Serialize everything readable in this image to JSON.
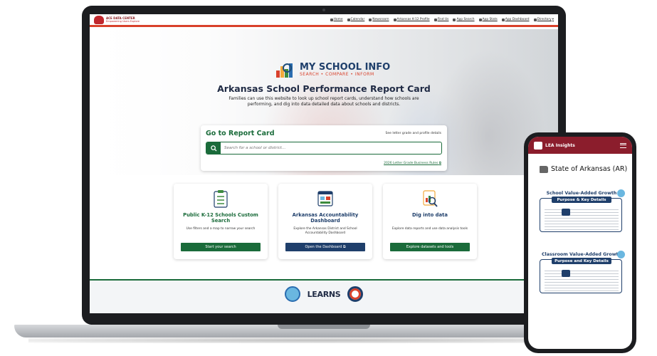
{
  "nav": {
    "brand_name": "ACE DATA CENTER",
    "brand_tagline": "Empowering Users Explore",
    "items": [
      {
        "label": "Home",
        "icon": "home-icon"
      },
      {
        "label": "Calendar",
        "icon": "calendar-icon"
      },
      {
        "label": "Newsroom",
        "icon": "newsroom-icon"
      },
      {
        "label": "Arkansas K-12 Profile",
        "icon": "profile-icon"
      },
      {
        "label": "Find Us",
        "icon": "map-pin-icon"
      },
      {
        "label": "App Search",
        "icon": "search-icon"
      },
      {
        "label": "App Stats",
        "icon": "stats-icon"
      },
      {
        "label": "App Dashboard",
        "icon": "dashboard-icon"
      },
      {
        "label": "Directory",
        "icon": "directory-icon"
      }
    ]
  },
  "hero": {
    "logo_title": "MY SCHOOL INFO",
    "logo_subtitle": "SEARCH • COMPARE • INFORM",
    "title": "Arkansas School Performance Report Card",
    "description": "Families can use this website to look up school report cards, understand how schools are performing, and dig into data detailed data about schools and districts."
  },
  "search": {
    "heading": "Go to Report Card",
    "side_link": "See letter grade and profile details",
    "placeholder": "Search for a school or district...",
    "rules_link": "2026 Letter Grade Business Rules"
  },
  "cards": [
    {
      "title": "Public K-12 Schools Custom Search",
      "desc": "Use filters and a map to narrow your search",
      "button": "Start your search",
      "icon": "checklist-icon",
      "button_color": "#1a6b3a"
    },
    {
      "title": "Arkansas Accountability Dashboard",
      "desc": "Explore the Arkansas District and School Accountability Dashboard",
      "button": "Open the Dashboard",
      "icon": "dashboard-icon",
      "button_color": "#1f3f6b"
    },
    {
      "title": "Dig into data",
      "desc": "Explore data reports and use data analysis tools",
      "button": "Explore datasets and tools",
      "icon": "magnifier-report-icon",
      "button_color": "#1a6b3a"
    }
  ],
  "footer": {
    "learns_text": "LEARNS"
  },
  "phone": {
    "app_title": "LEA Insights",
    "state_title": "State of Arkansas (AR)",
    "tiles": [
      {
        "title": "School Value-Added Growth",
        "band": "Purpose & Key Details"
      },
      {
        "title": "Classroom Value-Added Growth",
        "band": "Purpose and Key Details"
      }
    ]
  },
  "colors": {
    "accent_red": "#d9412b",
    "brand_green": "#1a6b3a",
    "brand_navy": "#1f3f6b",
    "phone_header": "#8b1d2c"
  }
}
